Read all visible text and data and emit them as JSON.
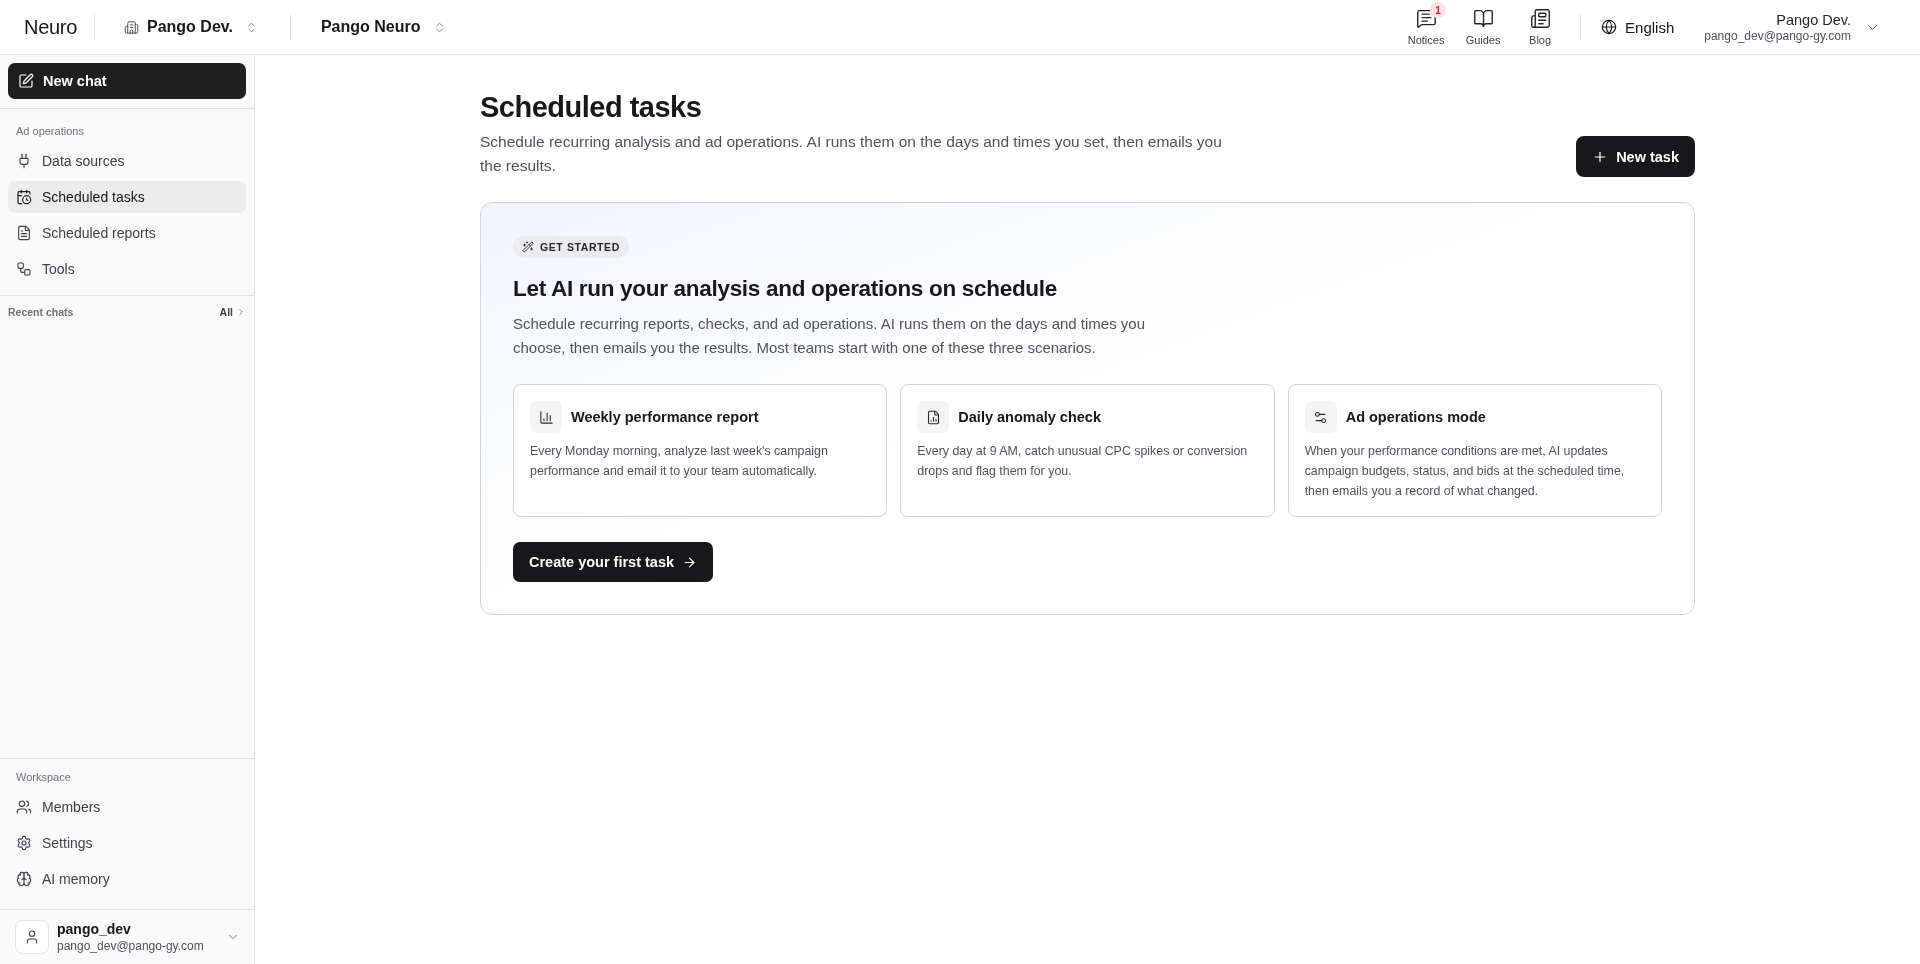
{
  "topbar": {
    "brand": "Neuro",
    "org_switcher": "Pango Dev.",
    "project_switcher": "Pango Neuro",
    "links": [
      {
        "label": "Notices",
        "badge": "1"
      },
      {
        "label": "Guides"
      },
      {
        "label": "Blog"
      }
    ],
    "language": "English",
    "account": {
      "name": "Pango Dev.",
      "email": "pango_dev@pango-gy.com"
    }
  },
  "sidebar": {
    "new_chat_button": "New chat",
    "ad_operations": {
      "heading": "Ad operations",
      "items": [
        {
          "label": "Data sources",
          "selected": false
        },
        {
          "label": "Scheduled tasks",
          "selected": true
        },
        {
          "label": "Scheduled reports",
          "selected": false
        },
        {
          "label": "Tools",
          "selected": false
        }
      ]
    },
    "recent_chats": {
      "heading": "Recent chats",
      "link": "All"
    },
    "workspace": {
      "heading": "Workspace",
      "items": [
        {
          "label": "Members",
          "selected": false
        },
        {
          "label": "Settings",
          "selected": false
        },
        {
          "label": "AI memory",
          "selected": false
        }
      ]
    },
    "user": {
      "name": "pango_dev",
      "email": "pango_dev@pango-gy.com"
    }
  },
  "page": {
    "title": "Scheduled tasks",
    "subtitle": "Schedule recurring analysis and ad operations. AI runs them on the days and times you set, then emails you the results.",
    "new_task_button": "New task"
  },
  "get_started": {
    "tag": "GET STARTED",
    "title": "Let AI run your analysis and operations on schedule",
    "description": "Schedule recurring reports, checks, and ad operations. AI runs them on the days and times you choose, then emails you the results. Most teams start with one of these three scenarios.",
    "scenarios": [
      {
        "title": "Weekly performance report",
        "description": "Every Monday morning, analyze last week's campaign performance and email it to your team automatically."
      },
      {
        "title": "Daily anomaly check",
        "description": "Every day at 9 AM, catch unusual CPC spikes or conversion drops and flag them for you."
      },
      {
        "title": "Ad operations mode",
        "description": "When your performance conditions are met, AI updates campaign budgets, status, and bids at the scheduled time, then emails you a record of what changed."
      }
    ],
    "cta_button": "Create your first task"
  }
}
